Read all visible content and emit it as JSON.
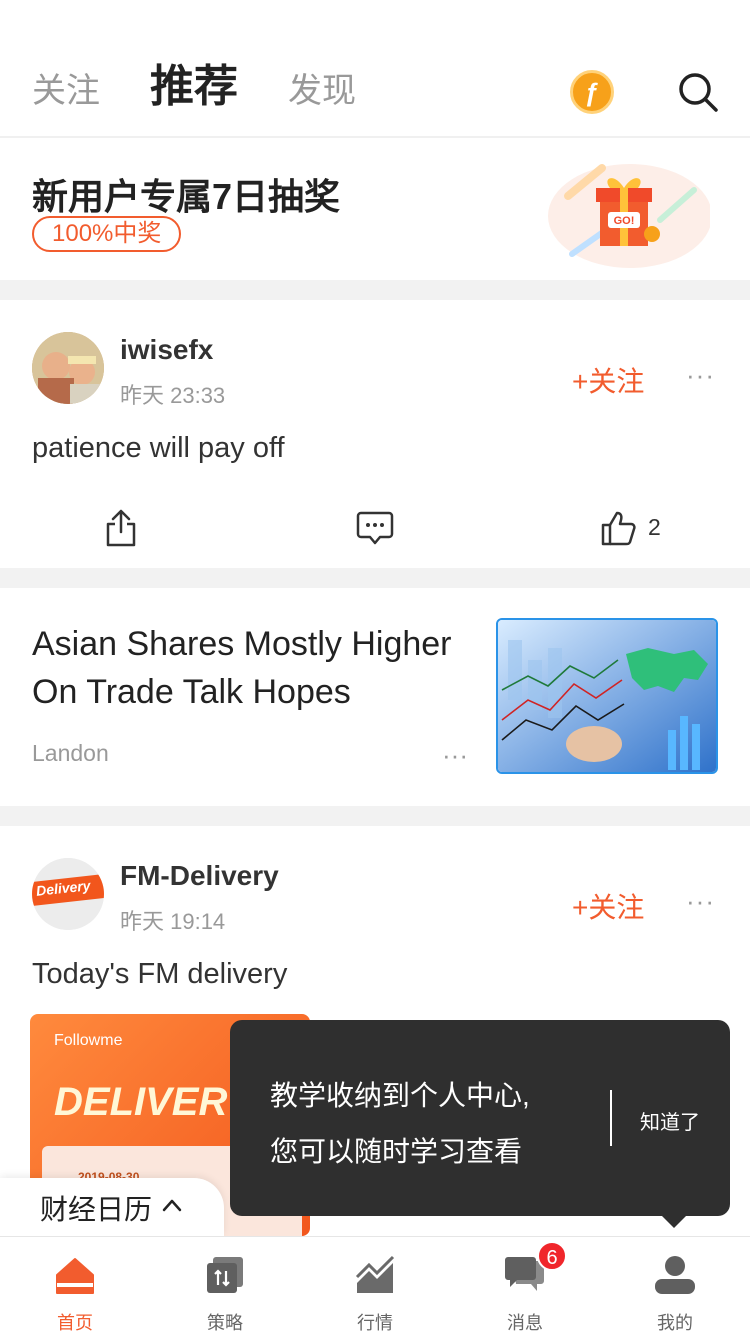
{
  "topnav": {
    "tabs": [
      "关注",
      "推荐",
      "发现"
    ],
    "active_tab": "推荐",
    "coin_glyph": "ƒ"
  },
  "promo": {
    "title": "新用户专属7日抽奖",
    "badge": "100%中奖",
    "gift_label": "GO!"
  },
  "post1": {
    "username": "iwisefx",
    "time": "昨天 23:33",
    "follow": "+关注",
    "more": "···",
    "text": "patience will pay off",
    "like_count": "2"
  },
  "article": {
    "title": "Asian Shares Mostly Higher On Trade Talk Hopes",
    "author": "Landon",
    "more": "···"
  },
  "post2": {
    "username": "FM-Delivery",
    "avatar_label": "Delivery",
    "time": "昨天 19:14",
    "follow": "+关注",
    "more": "···",
    "text": "Today's FM delivery",
    "preview_brand": "Followme",
    "preview_title": "DELIVERY",
    "preview_date": "2019-08-30"
  },
  "tooltip": {
    "text_line1": "教学收纳到个人中心,",
    "text_line2": "您可以随时学习查看",
    "button": "知道了"
  },
  "calendar": {
    "label": "财经日历"
  },
  "tabbar": {
    "items": [
      {
        "label": "首页",
        "icon": "home-icon"
      },
      {
        "label": "策略",
        "icon": "strategy-icon"
      },
      {
        "label": "行情",
        "icon": "market-icon"
      },
      {
        "label": "消息",
        "icon": "message-icon",
        "badge": "6"
      },
      {
        "label": "我的",
        "icon": "profile-icon"
      }
    ],
    "active": "首页"
  },
  "colors": {
    "accent": "#f25c2e",
    "coin": "#f7a11a",
    "tooltip_bg": "#2f2f2f",
    "badge": "#f0262b"
  }
}
